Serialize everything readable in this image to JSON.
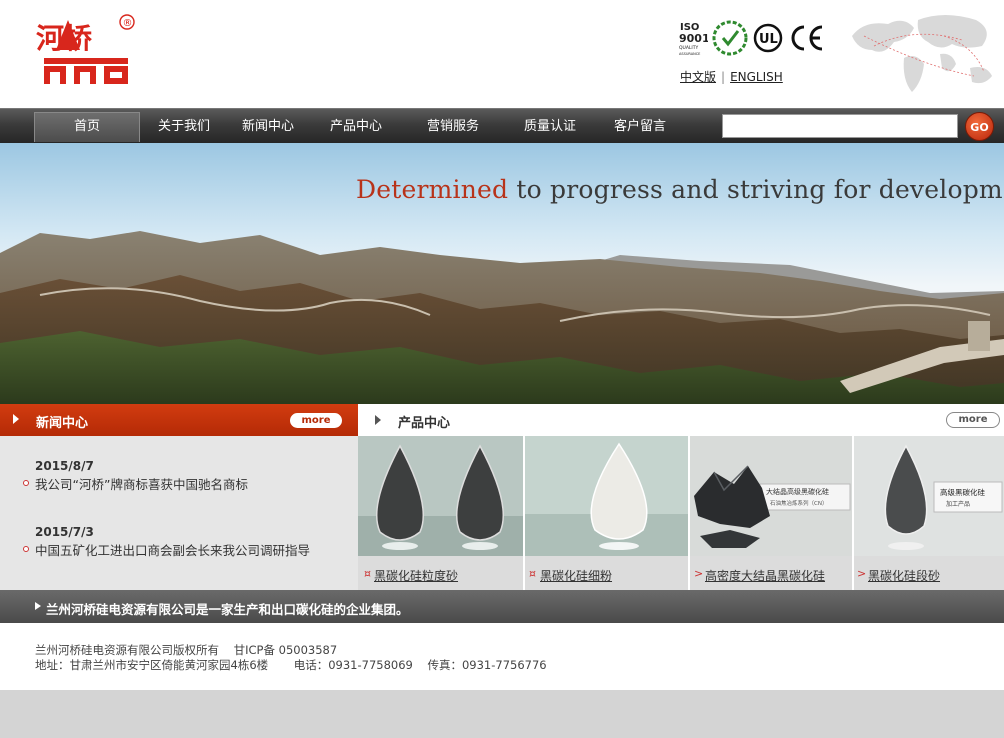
{
  "header": {
    "logo_text": "河桥",
    "logo_mark": "®",
    "cert_labels": [
      "ISO 9001 QUALITY ASSURANCE",
      "UL",
      "CE"
    ],
    "lang_chinese": "中文版",
    "lang_sep": "|",
    "lang_english": "ENGLISH"
  },
  "nav": {
    "items": [
      "首页",
      "关于我们",
      "新闻中心",
      "产品中心",
      "营销服务",
      "质量认证",
      "客户留言"
    ],
    "search_placeholder": "",
    "go_label": "GO"
  },
  "banner": {
    "headline_highlight": "Determined",
    "headline_rest": " to progress and striving for development"
  },
  "news": {
    "title": "新闻中心",
    "more_label": "more",
    "items": [
      {
        "date": "2015/8/7",
        "title": "我公司“河桥”牌商标喜获中国驰名商标"
      },
      {
        "date": "2015/7/3",
        "title": "中国五矿化工进出口商会副会长来我公司调研指导"
      }
    ]
  },
  "products": {
    "title": "产品中心",
    "more_label": "more",
    "items": [
      {
        "caption": "黑碳化硅粒度砂",
        "mark": "¤"
      },
      {
        "caption": "黑碳化硅细粉",
        "mark": "¤"
      },
      {
        "caption": "高密度大结晶黑碳化硅",
        "mark": ">"
      },
      {
        "caption": "黑碳化硅段砂",
        "mark": ">"
      }
    ],
    "image_labels": {
      "crystal": "大结晶高级黑碳化硅",
      "crystal_sub": "石油焦冶炼系列（CN）",
      "grit": "高级黑碳化硅",
      "grit_sub": "加工产品"
    }
  },
  "slogan": "兰州河桥硅电资源有限公司是一家生产和出口碳化硅的企业集团。",
  "footer": {
    "line1": "兰州河桥硅电资源有限公司版权所有    甘ICP备 05003587",
    "line2": "地址：甘肃兰州市安宁区倚能黄河家园4栋6楼       电话：0931-7758069    传真：0931-7756776"
  },
  "colors": {
    "brand_red": "#b42a06",
    "nav_dark": "#2e2e2e",
    "go_red": "#d2401a"
  }
}
